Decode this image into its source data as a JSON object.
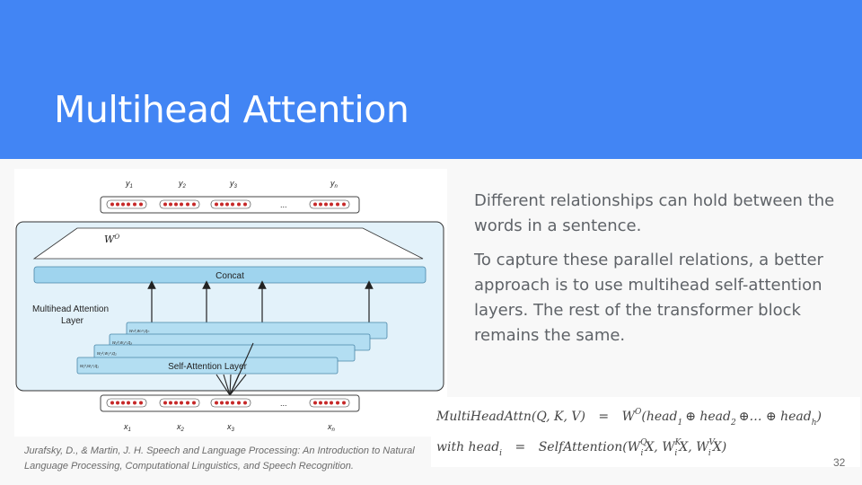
{
  "slide": {
    "title": "Multihead Attention",
    "page_number": "32",
    "paragraphs": [
      "Different relationships can hold between the words in a sentence.",
      "To capture these parallel relations, a better approach is to use multihead self-attention layers. The rest of the transformer block remains the same."
    ],
    "citation": "Jurafsky, D., & Martin, J. H. Speech and Language Processing: An Introduction to Natural Language Processing, Computational Linguistics, and Speech Recognition."
  },
  "diagram": {
    "outputs": [
      "y",
      "y",
      "y",
      "y"
    ],
    "output_subs": [
      "1",
      "2",
      "3",
      "n"
    ],
    "inputs": [
      "x",
      "x",
      "x",
      "x"
    ],
    "input_subs": [
      "1",
      "2",
      "3",
      "n"
    ],
    "ellipsis": "...",
    "wo_label": "W",
    "wo_sup": "O",
    "concat_label": "Concat",
    "group_label_line1": "Multihead Attention",
    "group_label_line2": "Layer",
    "self_attention_label": "Self-Attention Layer",
    "head_weight_labels": [
      "w₁ᵏ,w₁ᵛ,q₁",
      "w₂ᵏ,w₂ᵛ,q₂",
      "w₃ᵏ,w₃ᵛ,q₃",
      "wₕᵏ,wₕᵛ,qₕ"
    ]
  },
  "formula": {
    "line1": {
      "lhs": "MultiHeadAttn(Q, K, V)",
      "eq": "=",
      "w": "W",
      "w_sup": "O",
      "open": "(head",
      "s1": "1",
      "op1": "⊕ head",
      "s2": "2",
      "op2": "⊕… ⊕ head",
      "s3": "h",
      "close": ")"
    },
    "line2": {
      "lhs": "with head",
      "lhs_sub": "i",
      "eq": "=",
      "rhs": "SelfAttention(W",
      "q_sup": "Q",
      "q_sub": "i",
      "x1": "X, W",
      "k_sup": "K",
      "k_sub": "i",
      "x2": "X, W",
      "v_sup": "V",
      "v_sub": "i",
      "x3": "X)"
    }
  },
  "colors": {
    "header": "#4285f4",
    "layer_fill": "#c8e6f5",
    "concat_fill": "#9fd4ee",
    "vector_dot_red": "#c62828"
  }
}
